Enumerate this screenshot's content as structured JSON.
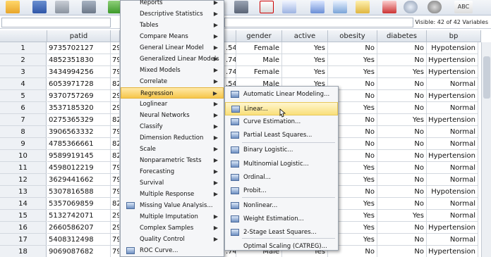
{
  "toolbar": {
    "icons": [
      "open-icon",
      "save-icon",
      "print-icon",
      "recall-icon",
      "check-icon",
      "find-icon",
      "cases-icon",
      "chart-icon",
      "grid-icon",
      "scale-icon",
      "table-icon",
      "split-icon",
      "circle-icon",
      "select-icon",
      "abc-icon"
    ],
    "abc_label": "ABC"
  },
  "editor": {
    "visible_count": "Visible: 42 of 42 Variables"
  },
  "grid": {
    "headers": {
      "patid": "patid",
      "gender": "gender",
      "active": "active",
      "obesity": "obesity",
      "diabetes": "diabetes",
      "bp": "bp"
    },
    "rows": [
      {
        "n": "1",
        "patid": "9735702127",
        "age": "29",
        "cut": ".54",
        "gender": "Female",
        "active": "Yes",
        "obesity": "No",
        "diabetes": "No",
        "bp": "Hypotension"
      },
      {
        "n": "2",
        "patid": "4852351830",
        "age": "79",
        "cut": ".74",
        "gender": "Male",
        "active": "Yes",
        "obesity": "Yes",
        "diabetes": "No",
        "bp": "Hypertension"
      },
      {
        "n": "3",
        "patid": "3434994256",
        "age": "79",
        "cut": ".74",
        "gender": "Female",
        "active": "Yes",
        "obesity": "Yes",
        "diabetes": "Yes",
        "bp": "Hypertension"
      },
      {
        "n": "4",
        "patid": "6053971728",
        "age": "82",
        "cut": ".54",
        "gender": "Male",
        "active": "Yes",
        "obesity": "No",
        "diabetes": "No",
        "bp": "Normal"
      },
      {
        "n": "5",
        "patid": "9370757269",
        "age": "29",
        "cut": "",
        "gender": "",
        "active": "",
        "obesity": "No",
        "diabetes": "No",
        "bp": "Hypertension"
      },
      {
        "n": "6",
        "patid": "3537185320",
        "age": "29",
        "cut": "",
        "gender": "",
        "active": "",
        "obesity": "Yes",
        "diabetes": "No",
        "bp": "Normal"
      },
      {
        "n": "7",
        "patid": "0275365329",
        "age": "82",
        "cut": "",
        "gender": "",
        "active": "",
        "obesity": "No",
        "diabetes": "Yes",
        "bp": "Hypertension"
      },
      {
        "n": "8",
        "patid": "3906563332",
        "age": "79",
        "cut": "",
        "gender": "",
        "active": "",
        "obesity": "No",
        "diabetes": "No",
        "bp": "Normal"
      },
      {
        "n": "9",
        "patid": "4785366661",
        "age": "82",
        "cut": "",
        "gender": "",
        "active": "",
        "obesity": "No",
        "diabetes": "No",
        "bp": "Normal"
      },
      {
        "n": "10",
        "patid": "9589919145",
        "age": "82",
        "cut": "",
        "gender": "",
        "active": "",
        "obesity": "No",
        "diabetes": "No",
        "bp": "Hypertension"
      },
      {
        "n": "11",
        "patid": "4598012219",
        "age": "79",
        "cut": "",
        "gender": "",
        "active": "",
        "obesity": "Yes",
        "diabetes": "No",
        "bp": "Normal"
      },
      {
        "n": "12",
        "patid": "3629441662",
        "age": "79",
        "cut": "",
        "gender": "",
        "active": "",
        "obesity": "Yes",
        "diabetes": "No",
        "bp": "Normal"
      },
      {
        "n": "13",
        "patid": "5307816588",
        "age": "79",
        "cut": "",
        "gender": "",
        "active": "",
        "obesity": "No",
        "diabetes": "No",
        "bp": "Hypotension"
      },
      {
        "n": "14",
        "patid": "5357069859",
        "age": "82",
        "cut": "",
        "gender": "",
        "active": "",
        "obesity": "Yes",
        "diabetes": "No",
        "bp": "Normal"
      },
      {
        "n": "15",
        "patid": "5132742071",
        "age": "29",
        "cut": "",
        "gender": "",
        "active": "",
        "obesity": "Yes",
        "diabetes": "Yes",
        "bp": "Normal"
      },
      {
        "n": "16",
        "patid": "2660586207",
        "age": "29",
        "cut": "",
        "gender": "",
        "active": "",
        "obesity": "Yes",
        "diabetes": "No",
        "bp": "Hypertension"
      },
      {
        "n": "17",
        "patid": "5408312498",
        "age": "79",
        "cut": "",
        "gender": "",
        "active": "",
        "obesity": "Yes",
        "diabetes": "No",
        "bp": "Normal"
      },
      {
        "n": "18",
        "patid": "9069087682",
        "age": "79",
        "cut": ".74",
        "gender": "Male",
        "active": "Yes",
        "obesity": "No",
        "diabetes": "No",
        "bp": "Hypertension"
      }
    ]
  },
  "analyze_menu": {
    "items": [
      {
        "label": "Reports",
        "arrow": true,
        "icon": false
      },
      {
        "label": "Descriptive Statistics",
        "arrow": true,
        "icon": false
      },
      {
        "label": "Tables",
        "arrow": true,
        "icon": false
      },
      {
        "label": "Compare Means",
        "arrow": true,
        "icon": false
      },
      {
        "label": "General Linear Model",
        "arrow": true,
        "icon": false
      },
      {
        "label": "Generalized Linear Models",
        "arrow": true,
        "icon": false
      },
      {
        "label": "Mixed Models",
        "arrow": true,
        "icon": false
      },
      {
        "label": "Correlate",
        "arrow": true,
        "icon": false
      },
      {
        "label": "Regression",
        "arrow": true,
        "icon": false,
        "highlight": true
      },
      {
        "label": "Loglinear",
        "arrow": true,
        "icon": false
      },
      {
        "label": "Neural Networks",
        "arrow": true,
        "icon": false
      },
      {
        "label": "Classify",
        "arrow": true,
        "icon": false
      },
      {
        "label": "Dimension Reduction",
        "arrow": true,
        "icon": false
      },
      {
        "label": "Scale",
        "arrow": true,
        "icon": false
      },
      {
        "label": "Nonparametric Tests",
        "arrow": true,
        "icon": false
      },
      {
        "label": "Forecasting",
        "arrow": true,
        "icon": false
      },
      {
        "label": "Survival",
        "arrow": true,
        "icon": false
      },
      {
        "label": "Multiple Response",
        "arrow": true,
        "icon": false
      },
      {
        "label": "Missing Value Analysis...",
        "arrow": false,
        "icon": true
      },
      {
        "label": "Multiple Imputation",
        "arrow": true,
        "icon": false
      },
      {
        "label": "Complex Samples",
        "arrow": true,
        "icon": false
      },
      {
        "label": "Quality Control",
        "arrow": true,
        "icon": false
      },
      {
        "label": "ROC Curve...",
        "arrow": false,
        "icon": true
      }
    ]
  },
  "regression_menu": {
    "items": [
      {
        "label": "Automatic Linear Modeling..."
      },
      {
        "label": "Linear...",
        "highlight": true
      },
      {
        "label": "Curve Estimation..."
      },
      {
        "label": "Partial Least Squares..."
      },
      {
        "label": "Binary Logistic..."
      },
      {
        "label": "Multinomial Logistic..."
      },
      {
        "label": "Ordinal..."
      },
      {
        "label": "Probit..."
      },
      {
        "label": "Nonlinear..."
      },
      {
        "label": "Weight Estimation..."
      },
      {
        "label": "2-Stage Least Squares..."
      },
      {
        "label": "Optimal Scaling (CATREG)..."
      }
    ]
  }
}
